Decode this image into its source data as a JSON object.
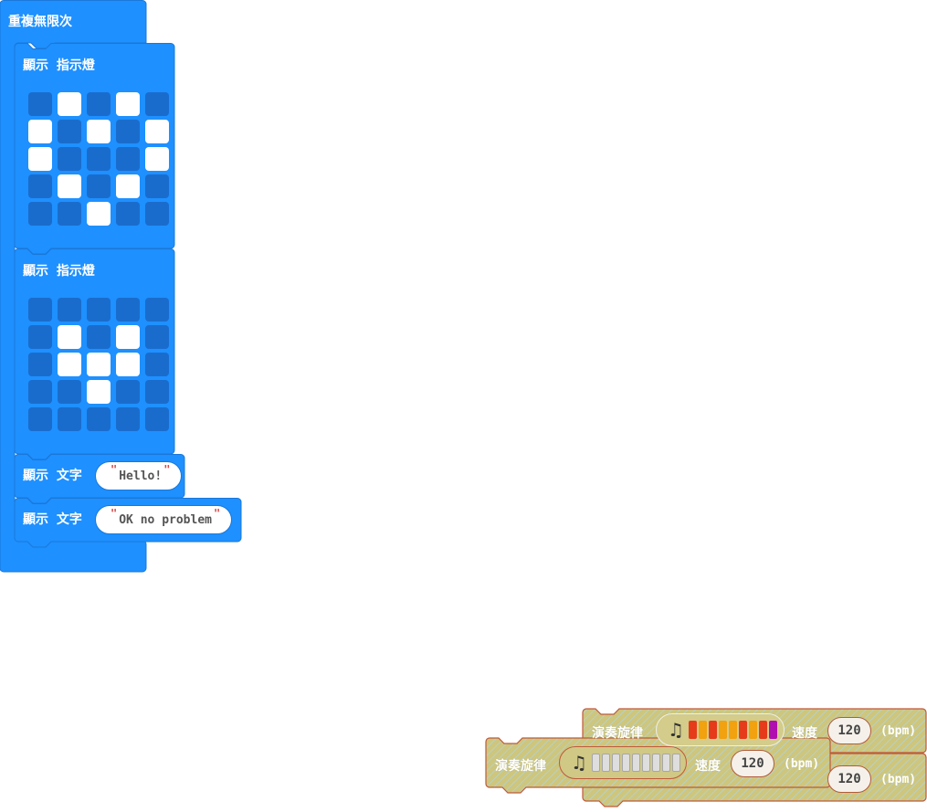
{
  "repeat_block": {
    "label": "重複無限次"
  },
  "show_leds_1": {
    "label": "顯示 指示燈",
    "matrix": [
      [
        0,
        1,
        0,
        1,
        0
      ],
      [
        1,
        0,
        1,
        0,
        1
      ],
      [
        1,
        0,
        0,
        0,
        1
      ],
      [
        0,
        1,
        0,
        1,
        0
      ],
      [
        0,
        0,
        1,
        0,
        0
      ]
    ]
  },
  "show_leds_2": {
    "label": "顯示 指示燈",
    "matrix": [
      [
        0,
        0,
        0,
        0,
        0
      ],
      [
        0,
        1,
        0,
        1,
        0
      ],
      [
        0,
        1,
        1,
        1,
        0
      ],
      [
        0,
        0,
        1,
        0,
        0
      ],
      [
        0,
        0,
        0,
        0,
        0
      ]
    ]
  },
  "show_string_1": {
    "label": "顯示 文字",
    "value": "Hello!",
    "open_quote": "\"",
    "close_quote": "\""
  },
  "show_string_2": {
    "label": "顯示 文字",
    "value": "OK no problem",
    "open_quote": "\"",
    "close_quote": "\""
  },
  "music_back": {
    "label": "演奏旋律",
    "tempo_label": "速度",
    "tempo": "120",
    "unit": "(bpm)",
    "note_colors": [
      "#e53b1a",
      "#f2a10f",
      "#e53b1a",
      "#f2a10f",
      "#f2a10f",
      "#e53b1a",
      "#f2a10f",
      "#e53b1a",
      "#b00faf"
    ]
  },
  "music_back_2": {
    "tempo": "120",
    "unit": "(bpm)"
  },
  "music_front": {
    "label": "演奏旋律",
    "tempo_label": "速度",
    "tempo": "120",
    "unit": "(bpm)",
    "note_count": 9
  },
  "colors": {
    "basic_blue": "#1e90ff",
    "basic_border": "#1b78d8",
    "music_fill": "#c9c37a",
    "music_border": "#c0593a"
  }
}
